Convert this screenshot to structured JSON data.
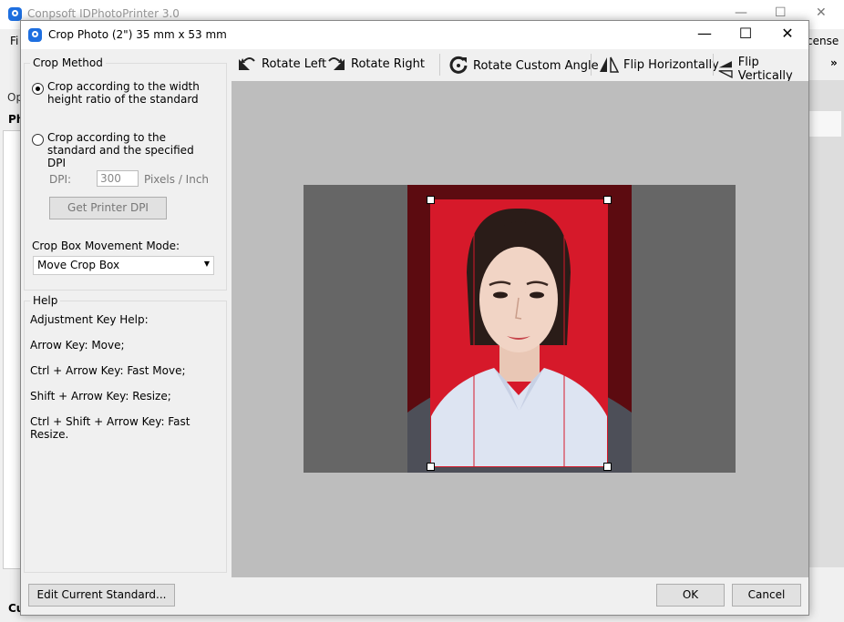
{
  "background_app": {
    "title": "Conpsoft IDPhotoPrinter 3.0",
    "menu_left": "Fi",
    "menu_right": "cense",
    "side_label_op": "Op",
    "side_label_ph": "Ph",
    "side_label_cu": "Cu",
    "overflow": "»"
  },
  "dialog": {
    "title": "Crop Photo (2\") 35 mm x 53 mm",
    "controls": {
      "minimize": "—",
      "maximize": "☐",
      "close": "✕"
    }
  },
  "crop_method": {
    "legend": "Crop Method",
    "option1": "Crop according to the width height ratio of the standard",
    "option2": "Crop according to the standard and the specified DPI",
    "selected": "option1",
    "dpi_label": "DPI:",
    "dpi_value": "300",
    "dpi_unit": "Pixels / Inch",
    "printer_dpi_button": "Get Printer DPI",
    "movement_label": "Crop Box Movement Mode:",
    "movement_value": "Move Crop Box"
  },
  "help": {
    "legend": "Help",
    "lines": [
      "Adjustment Key Help:",
      "Arrow Key: Move;",
      "Ctrl + Arrow Key: Fast Move;",
      "Shift + Arrow Key: Resize;",
      "Ctrl + Shift + Arrow Key: Fast Resize."
    ]
  },
  "toolbar": {
    "rotate_left": "Rotate Left",
    "rotate_right": "Rotate Right",
    "rotate_custom": "Rotate Custom Angle",
    "flip_h": "Flip Horizontally",
    "flip_v": "Flip Vertically"
  },
  "footer": {
    "edit_standard": "Edit Current Standard...",
    "ok": "OK",
    "cancel": "Cancel"
  },
  "colors": {
    "photo_backdrop": "#d6192a",
    "outside_crop": "#5c0b10",
    "canvas": "#bdbdbd"
  }
}
